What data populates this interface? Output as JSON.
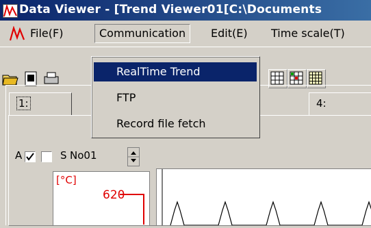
{
  "window": {
    "title": "Data Viewer - [Trend Viewer01[C:\\Documents"
  },
  "menubar": {
    "items": [
      {
        "label": "File(F)"
      },
      {
        "label": "Communication"
      },
      {
        "label": "Edit(E)"
      },
      {
        "label": "Time scale(T)"
      }
    ]
  },
  "dropdown": {
    "items": [
      {
        "label": "RealTime Trend",
        "highlighted": true
      },
      {
        "label": "FTP",
        "highlighted": false
      },
      {
        "label": "Record file fetch",
        "highlighted": false
      }
    ]
  },
  "tabs": [
    {
      "label": "1:"
    },
    {
      "label": "4:"
    }
  ],
  "channel_controls": {
    "a_label": "A",
    "s_label": "S",
    "channel": "No01",
    "a_checked": true,
    "s_checked": false
  },
  "axis": {
    "unit": "[°C]",
    "tick_value": "620"
  },
  "colors": {
    "title_bar": "#0a246a",
    "accent_red": "#e00000",
    "menu_highlight": "#0a246a"
  }
}
